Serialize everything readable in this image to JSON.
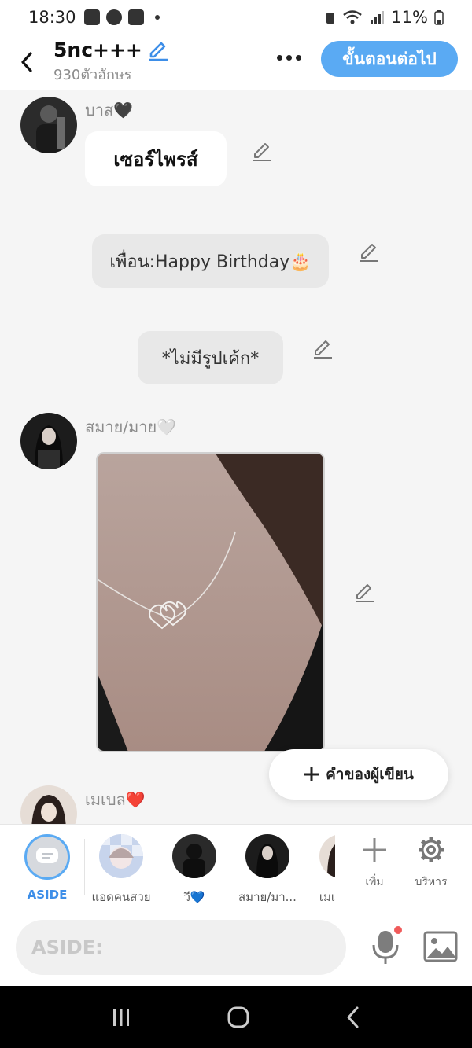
{
  "status": {
    "time": "18:30",
    "battery": "11%"
  },
  "header": {
    "title": "5nc+++",
    "char_count": "930ตัวอักษร",
    "next_label": "ขั้นตอนต่อไป"
  },
  "messages": {
    "m1_name": "บาส🖤",
    "m1_text": "เซอร์ไพรส์",
    "m2_text": "เพื่อน:Happy Birthday🎂",
    "m3_text": "*ไม่มีรูปเค้ก*",
    "m4_name": "สมาย/มาย🤍",
    "m5_name": "เมเบล❤️"
  },
  "author_button": {
    "label": "คำของผู้เขียน"
  },
  "characters": {
    "aside": "ASIDE",
    "c1": "แอดคนสวย",
    "c2": "วี💙",
    "c3": "สมาย/มา...",
    "c4": "เมเ",
    "add": "เพิ่ม",
    "manage": "บริหาร"
  },
  "input": {
    "placeholder": "ASIDE:"
  },
  "colors": {
    "accent": "#5aaaf3",
    "aside_label": "#3d8ee8"
  }
}
